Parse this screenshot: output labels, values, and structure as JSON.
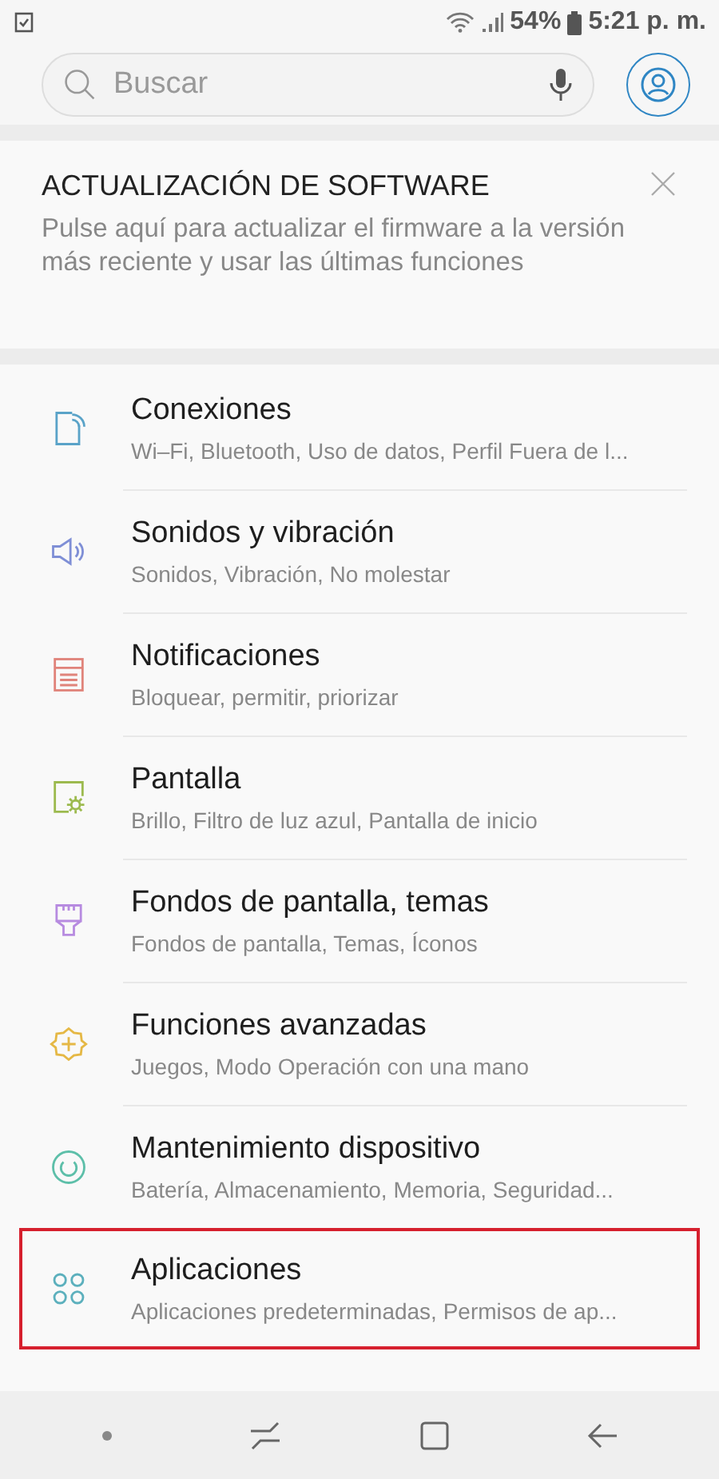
{
  "status_bar": {
    "battery": "54%",
    "time": "5:21 p. m."
  },
  "search": {
    "placeholder": "Buscar"
  },
  "update_card": {
    "title": "ACTUALIZACIÓN DE SOFTWARE",
    "text": "Pulse aquí para actualizar el firmware a la versión más reciente y usar las últimas funciones"
  },
  "settings": [
    {
      "kind": "connections",
      "color": "#5aa3c8",
      "title": "Conexiones",
      "subtitle": "Wi–Fi, Bluetooth, Uso de datos, Perfil Fuera de l...",
      "highlighted": false
    },
    {
      "kind": "sound",
      "color": "#7f8fd6",
      "title": "Sonidos y vibración",
      "subtitle": "Sonidos, Vibración, No molestar",
      "highlighted": false
    },
    {
      "kind": "notifications",
      "color": "#e0837a",
      "title": "Notificaciones",
      "subtitle": "Bloquear, permitir, priorizar",
      "highlighted": false
    },
    {
      "kind": "display",
      "color": "#9cba4e",
      "title": "Pantalla",
      "subtitle": "Brillo, Filtro de luz azul, Pantalla de inicio",
      "highlighted": false
    },
    {
      "kind": "wallpaper",
      "color": "#b78be0",
      "title": "Fondos de pantalla, temas",
      "subtitle": "Fondos de pantalla, Temas, Íconos",
      "highlighted": false
    },
    {
      "kind": "advanced",
      "color": "#e5b845",
      "title": "Funciones avanzadas",
      "subtitle": "Juegos, Modo Operación con una mano",
      "highlighted": false
    },
    {
      "kind": "maintenance",
      "color": "#5dbfa9",
      "title": "Mantenimiento dispositivo",
      "subtitle": "Batería, Almacenamiento, Memoria, Seguridad...",
      "highlighted": false
    },
    {
      "kind": "apps",
      "color": "#5cb0bd",
      "title": "Aplicaciones",
      "subtitle": "Aplicaciones predeterminadas, Permisos de ap...",
      "highlighted": true
    }
  ]
}
